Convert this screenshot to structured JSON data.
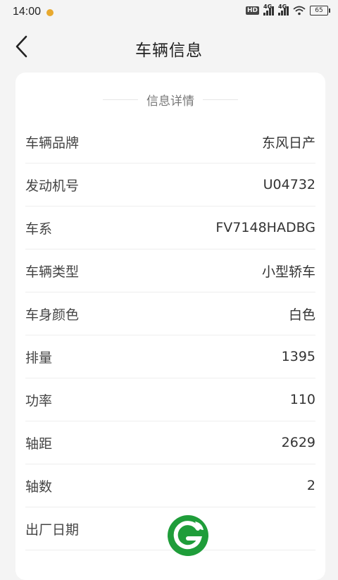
{
  "status_bar": {
    "time": "14:00",
    "network_1": "4G",
    "network_2": "4G",
    "hd_label": "HD",
    "battery": "65"
  },
  "header": {
    "title": "车辆信息"
  },
  "section": {
    "title": "信息详情"
  },
  "rows": [
    {
      "label": "车辆品牌",
      "value": "东风日产"
    },
    {
      "label": "发动机号",
      "value": "U04732"
    },
    {
      "label": "车系",
      "value": "FV7148HADBG"
    },
    {
      "label": "车辆类型",
      "value": "小型轿车"
    },
    {
      "label": "车身颜色",
      "value": "白色"
    },
    {
      "label": "排量",
      "value": "1395"
    },
    {
      "label": "功率",
      "value": "110"
    },
    {
      "label": "轴距",
      "value": "2629"
    },
    {
      "label": "轴数",
      "value": "2"
    },
    {
      "label": "出厂日期",
      "value": ""
    }
  ],
  "colors": {
    "background": "#f4f4f4",
    "card": "#ffffff",
    "logo_green": "#1f9d3a"
  }
}
